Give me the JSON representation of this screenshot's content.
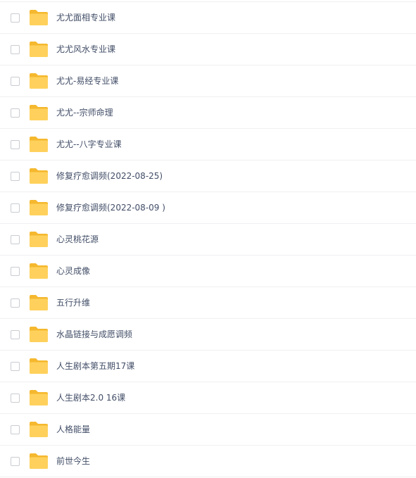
{
  "files": [
    {
      "name": "尤尤面相专业课",
      "icon": "folder-icon"
    },
    {
      "name": "尤尤风水专业课",
      "icon": "folder-icon"
    },
    {
      "name": "尤尤-易经专业课",
      "icon": "folder-icon"
    },
    {
      "name": "尤尤--宗师命理",
      "icon": "folder-icon"
    },
    {
      "name": "尤尤--八字专业课",
      "icon": "folder-icon"
    },
    {
      "name": "修复疗愈调频(2022-08-25)",
      "icon": "folder-icon"
    },
    {
      "name": "修复疗愈调频(2022-08-09 )",
      "icon": "folder-icon"
    },
    {
      "name": "心灵桃花源",
      "icon": "folder-icon"
    },
    {
      "name": "心灵成像",
      "icon": "folder-icon"
    },
    {
      "name": "五行升维",
      "icon": "folder-icon"
    },
    {
      "name": "水晶链接与成愿调频",
      "icon": "folder-icon"
    },
    {
      "name": "人生剧本第五期17课",
      "icon": "folder-icon"
    },
    {
      "name": "人生剧本2.0 16课",
      "icon": "folder-icon"
    },
    {
      "name": "人格能量",
      "icon": "folder-icon"
    },
    {
      "name": "前世今生",
      "icon": "folder-icon"
    }
  ],
  "colors": {
    "folder_back": "#f5b82e",
    "folder_front": "#ffd15c",
    "text": "#424e67",
    "divider": "#f0f0f2",
    "checkbox_border": "#c9ccd2"
  }
}
